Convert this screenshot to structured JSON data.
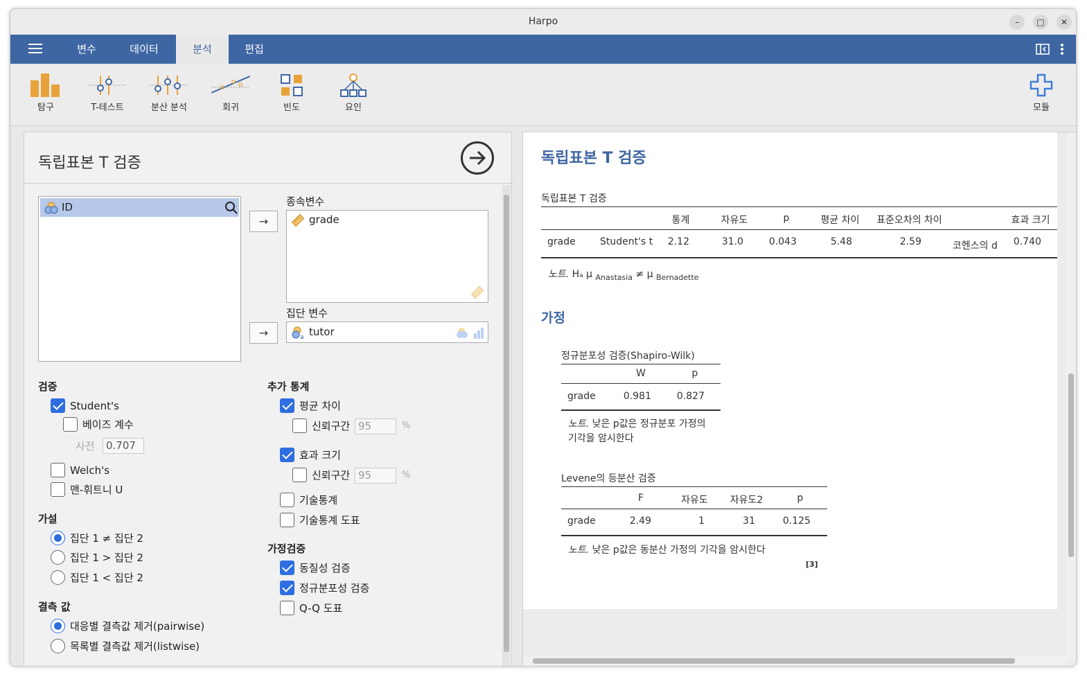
{
  "window": {
    "title": "Harpo"
  },
  "menu": {
    "tabs": [
      "변수",
      "데이터",
      "분석",
      "편집"
    ],
    "active": "분석"
  },
  "toolbar": {
    "tools": [
      "탐구",
      "T-테스트",
      "분산 분석",
      "회귀",
      "빈도",
      "요인"
    ],
    "modules": "모듈"
  },
  "panel": {
    "title": "독립표본 T 검증",
    "variables": [
      "ID"
    ],
    "dependent_label": "종속변수",
    "dependent_vars": [
      "grade"
    ],
    "group_label": "집단 변수",
    "group_var": "tutor",
    "tests": {
      "title": "검증",
      "students": {
        "label": "Student's",
        "checked": true
      },
      "bayes": {
        "label": "베이즈 계수",
        "checked": false
      },
      "prior_label": "사전",
      "prior_value": "0.707",
      "welch": {
        "label": "Welch's",
        "checked": false
      },
      "mann": {
        "label": "맨-휘트니 U",
        "checked": false
      }
    },
    "hypothesis": {
      "title": "가설",
      "options": [
        "집단 1 ≠ 집단 2",
        "집단 1 > 집단 2",
        "집단 1 < 집단 2"
      ],
      "selected": 0
    },
    "missing": {
      "title": "결측 값",
      "options": [
        "대응별 결측값 제거(pairwise)",
        "목록별 결측값 제거(listwise)"
      ],
      "selected": 0
    },
    "additional": {
      "title": "추가 통계",
      "mean_diff": {
        "label": "평균 차이",
        "checked": true
      },
      "ci1": {
        "label": "신뢰구간",
        "checked": false,
        "value": "95",
        "unit": "%"
      },
      "effect": {
        "label": "효과 크기",
        "checked": true
      },
      "ci2": {
        "label": "신뢰구간",
        "checked": false,
        "value": "95",
        "unit": "%"
      },
      "desc": {
        "label": "기술통계",
        "checked": false
      },
      "desc_plot": {
        "label": "기술통계 도표",
        "checked": false
      }
    },
    "assumptions": {
      "title": "가정검증",
      "homogeneity": {
        "label": "동질성 검증",
        "checked": true
      },
      "normality": {
        "label": "정규분포성 검증",
        "checked": true
      },
      "qq": {
        "label": "Q-Q 도표",
        "checked": false
      }
    }
  },
  "results": {
    "title": "독립표본 T 검증",
    "ttest": {
      "caption": "독립표본 T 검증",
      "headers": [
        "통계",
        "자유도",
        "p",
        "평균 차이",
        "표준오차의 차이",
        "효과 크기"
      ],
      "row": {
        "var": "grade",
        "test": "Student's t",
        "stat": "2.12",
        "df": "31.0",
        "p": "0.043",
        "md": "5.48",
        "se": "2.59",
        "es_label": "코헨스의 d",
        "es": "0.740"
      },
      "note_prefix": "노트.",
      "note_h": "Hₐ μ",
      "note_g1": "Anastasia",
      "note_ne": "≠ μ",
      "note_g2": "Bernadette"
    },
    "assumptions_title": "가정",
    "normality": {
      "caption": "정규분포성 검증(Shapiro-Wilk)",
      "headers": [
        "W",
        "p"
      ],
      "row": [
        "grade",
        "0.981",
        "0.827"
      ],
      "note_prefix": "노트.",
      "note_line1": "낮은 p값은 정규분포 가정의",
      "note_line2": "기각을 암시한다"
    },
    "levene": {
      "caption": "Levene의 등분산 검증",
      "headers": [
        "F",
        "자유도",
        "자유도2",
        "p"
      ],
      "row": [
        "grade",
        "2.49",
        "1",
        "31",
        "0.125"
      ],
      "note_prefix": "노트.",
      "note": "낮은 p값은 동분산 가정의 기각을 암시한다",
      "ref": "[3]"
    }
  }
}
